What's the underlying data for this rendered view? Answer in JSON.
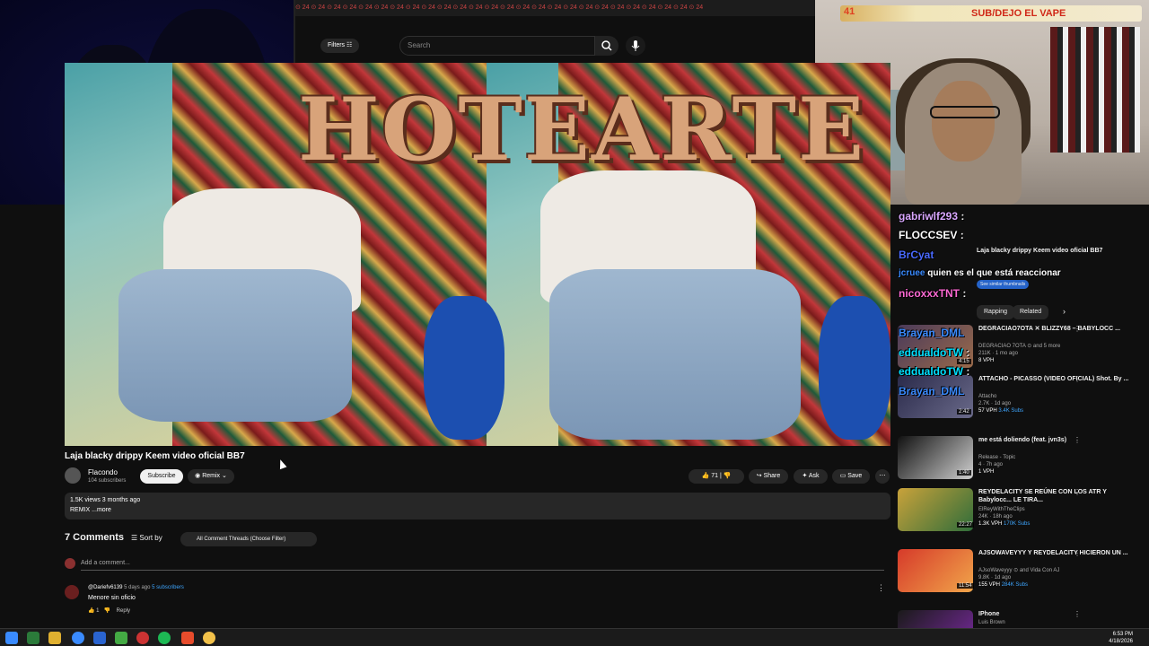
{
  "browser": {
    "filters_label": "Filters",
    "search_placeholder": "Search"
  },
  "overlay": {
    "count": "41",
    "banner_text": "SUB/DEJO EL VAPE"
  },
  "video": {
    "headline_text": "HOTEARTE",
    "title": "Laja blacky drippy Keem video oficial BB7",
    "channel_name": "Flacondo",
    "channel_subs": "104 subscribers",
    "subscribe_label": "Subscribe",
    "remix_label": "Remix",
    "like_count": "71",
    "share_label": "Share",
    "ask_label": "Ask",
    "save_label": "Save",
    "views": "1.5K views  3 months ago",
    "description": "REMIX ...more"
  },
  "comments": {
    "count_label": "7 Comments",
    "sort_label": "Sort by",
    "filter_label": "All Comment Threads (Choose Filter)",
    "add_placeholder": "Add a comment...",
    "items": [
      {
        "author": "@Dariefv6139",
        "age": "5 days ago",
        "subs": "5 subscribers",
        "text": "Menore sin oficio",
        "likes": "1",
        "reply": "Reply"
      }
    ]
  },
  "sidebar": {
    "top_card": {
      "title": "Laja blacky drippy Keem video oficial BB7",
      "button": "See similar thumbnails"
    },
    "chips": [
      "Rapping",
      "Related"
    ],
    "recommendations": [
      {
        "title": "DEGRACIAO7OTA ✕ BLIZZY68 – BABYLOCC ...",
        "channel": "DEGRACIAO 7OTA ⊙ and 5 more",
        "meta": "211K · 1 mo ago",
        "badge": "8 VPH",
        "duration": "4:15"
      },
      {
        "title": "ATTACHO - PICASSO (VIDEO OFICIAL) Shot. By ...",
        "channel": "Attacho",
        "meta": "2.7K · 1d ago",
        "badge": "57 VPH",
        "subs": "3.4K Subs",
        "duration": "2:42"
      },
      {
        "title": "me está doliendo (feat. jvn3s)",
        "channel": "Release - Topic",
        "meta": "4 · 7h ago",
        "badge": "1 VPH",
        "duration": "1:40"
      },
      {
        "title": "REYDELACITY SE REÚNE CON LOS ATR Y Babylocc... LE TIRA...",
        "channel": "ElReyWithTheClips",
        "meta": "24K · 18h ago",
        "badge": "1.3K VPH",
        "subs": "170K Subs",
        "duration": "22:27"
      },
      {
        "title": "AJSOWAVEYYY Y REYDELACITY HICIERON UN ...",
        "channel": "AJsoWaveyyy ⊙ and Vida Con AJ",
        "meta": "9.8K · 1d ago",
        "badge": "155 VPH",
        "subs": "284K Subs",
        "duration": "11:54"
      },
      {
        "title": "IPhone",
        "channel": "Luis Brown",
        "meta": "",
        "badge": "",
        "duration": ""
      }
    ]
  },
  "chat": [
    {
      "user": "gabriwlf293",
      "msg": ":",
      "color": "#d9a7ff"
    },
    {
      "user": "FLOCCSEV",
      "msg": ":",
      "color": "#ffffff"
    },
    {
      "user": "BrCyat",
      "msg": "",
      "color": "#4a6aff"
    },
    {
      "user": "jcruee",
      "msg": "quien es el que está reaccionar",
      "color": "#3a8bff"
    },
    {
      "user": "nicoxxxTNT",
      "msg": ":",
      "color": "#ff6ad5"
    },
    {
      "user": "Brayan_DML",
      "msg": "",
      "color": "#3a8bff"
    },
    {
      "user": "eddualdoTW",
      "msg": ":",
      "color": "#00e0ff"
    },
    {
      "user": "eddualdoTW",
      "msg": ":",
      "color": "#00e0ff"
    },
    {
      "user": "Brayan_DML",
      "msg": "",
      "color": "#3a8bff"
    }
  ],
  "taskbar": {
    "time": "6:53 PM",
    "date": "4/18/2026"
  }
}
